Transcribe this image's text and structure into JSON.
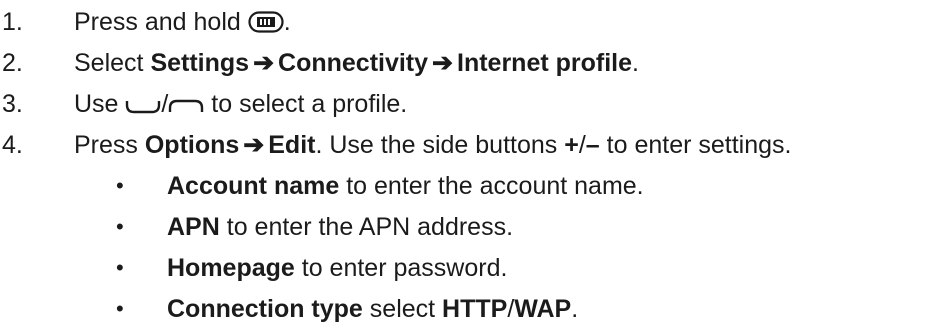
{
  "steps": [
    {
      "num": "1.",
      "pre": "Press and hold ",
      "post": "."
    },
    {
      "num": "2.",
      "pre": "Select ",
      "b1": "Settings",
      "arrow": "➔",
      "b2": "Connectivity",
      "b3": "Internet profile",
      "post": "."
    },
    {
      "num": "3.",
      "pre": "Use ",
      "sep": "/",
      "post": " to select a profile."
    },
    {
      "num": "4.",
      "pre": "Press ",
      "b1": "Options",
      "arrow": "➔",
      "b2": "Edit",
      "mid": ". Use the side buttons ",
      "plus": "+",
      "slash": "/",
      "minus": "–",
      "post": " to enter settings."
    }
  ],
  "bullets": [
    {
      "bold": "Account name",
      "rest": " to enter the account name."
    },
    {
      "bold": "APN",
      "rest": " to enter the APN address."
    },
    {
      "bold": "Homepage",
      "rest": " to enter password."
    },
    {
      "bold": "Connection type",
      "rest": " select ",
      "b2": "HTTP",
      "sep": "/",
      "b3": "WAP",
      "end": "."
    }
  ],
  "bullet_char": "•",
  "icons": [
    "menu-key-icon",
    "nav-down-icon",
    "nav-up-icon"
  ]
}
